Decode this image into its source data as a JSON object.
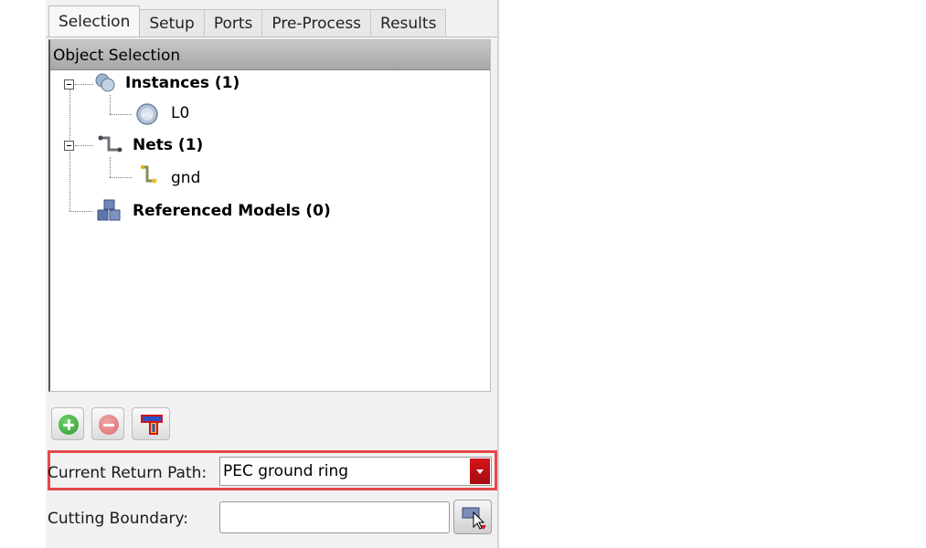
{
  "tabs": [
    "Selection",
    "Setup",
    "Ports",
    "Pre-Process",
    "Results"
  ],
  "tree": {
    "header": "Object Selection",
    "instances": {
      "label": "Instances (1)",
      "child": "L0",
      "child_icon": "obj"
    },
    "nets": {
      "label": "Nets (1)",
      "child": "gnd"
    },
    "models": {
      "label": "Referenced Models (0)"
    }
  },
  "toolbar": {
    "add": "add-icon",
    "remove": "remove-icon",
    "port": "port-icon"
  },
  "return_path": {
    "label": "Current Return Path:",
    "value": "PEC ground ring"
  },
  "cutting_boundary": {
    "label": "Cutting Boundary:",
    "value": ""
  },
  "colors": {
    "highlight": "#e5484d",
    "dropdown_accent": "#c0111a",
    "add_green": "#35a636",
    "remove_red": "#e0787a"
  }
}
